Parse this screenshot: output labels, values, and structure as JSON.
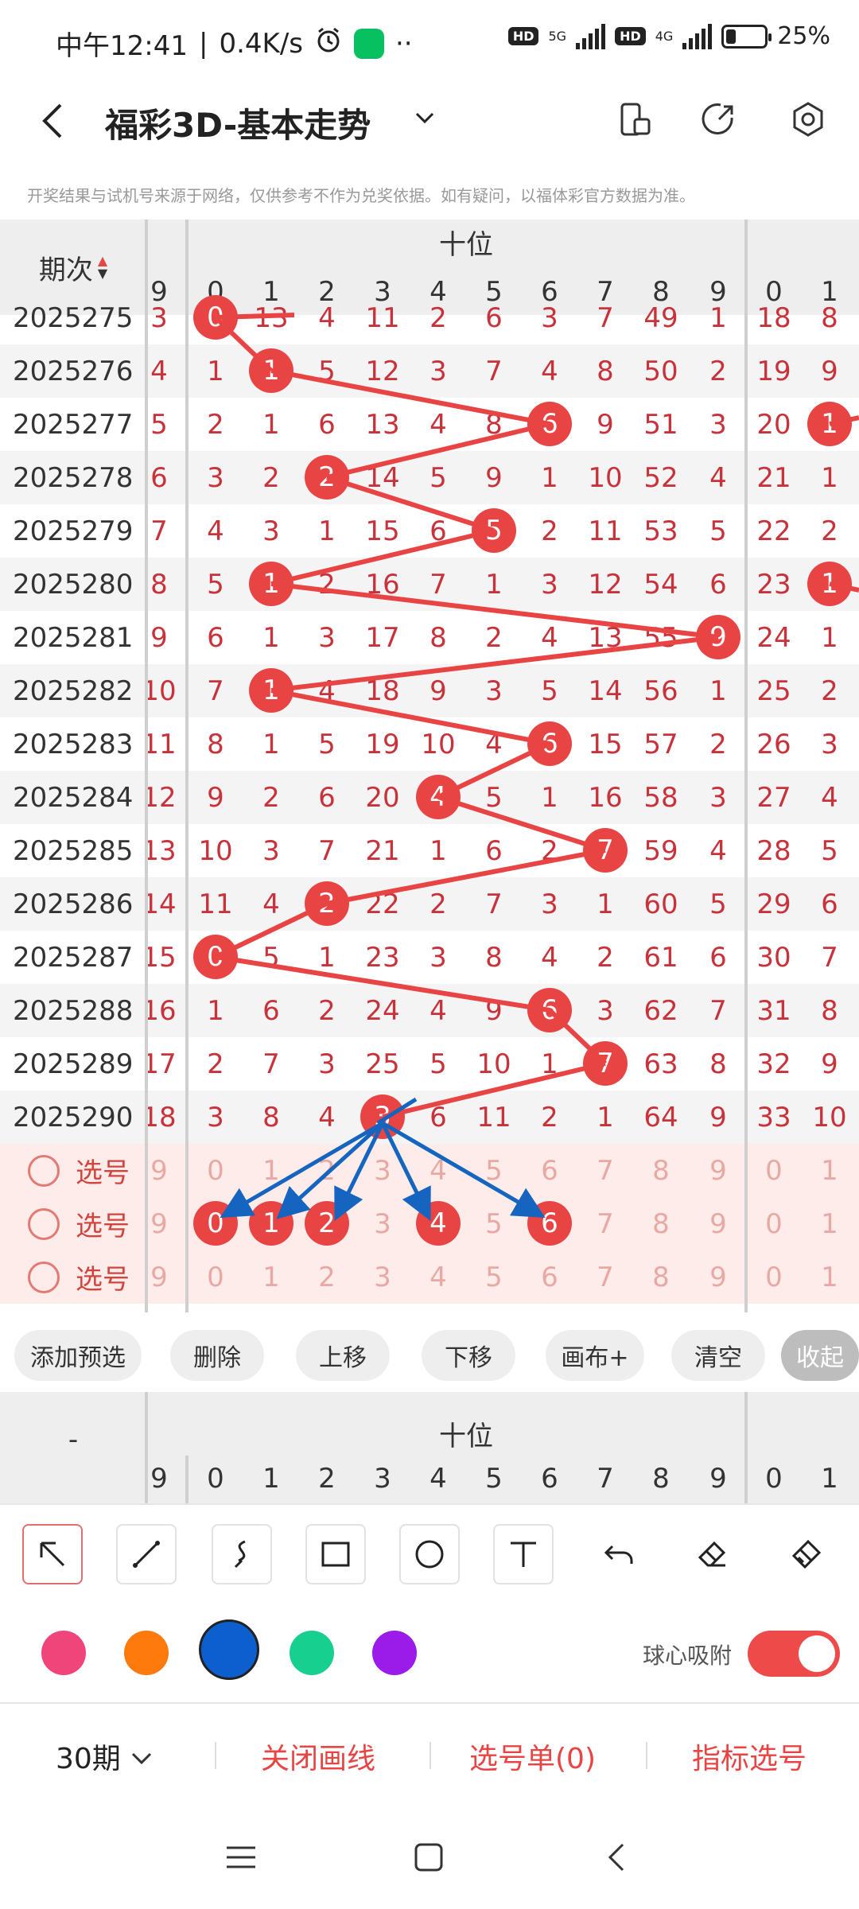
{
  "status": {
    "time": "中午12:41",
    "speed": "0.4K/s",
    "hd1": "HD",
    "net1": "5G",
    "hd2": "HD",
    "net2": "4G",
    "battery": "25%",
    "battery_level": 0.25
  },
  "header": {
    "title": "福彩3D-基本走势"
  },
  "disclaimer": "开奖结果与试机号来源于网络，仅供参考不作为兑奖依据。如有疑问，以福体彩官方数据为准。",
  "grid": {
    "issue_header": "期次",
    "position": "十位",
    "columns": [
      "9",
      "0",
      "1",
      "2",
      "3",
      "4",
      "5",
      "6",
      "7",
      "8",
      "9",
      "0",
      "1"
    ],
    "rows": [
      {
        "issue": "2025275",
        "cells": [
          "3",
          "0",
          "13",
          "4",
          "11",
          "2",
          "6",
          "3",
          "7",
          "49",
          "1",
          "18",
          "8"
        ],
        "ball": 1
      },
      {
        "issue": "2025276",
        "cells": [
          "4",
          "1",
          "1",
          "5",
          "12",
          "3",
          "7",
          "4",
          "8",
          "50",
          "2",
          "19",
          "9"
        ],
        "ball": 2
      },
      {
        "issue": "2025277",
        "cells": [
          "5",
          "2",
          "1",
          "6",
          "13",
          "4",
          "8",
          "6",
          "9",
          "51",
          "3",
          "20",
          "1"
        ],
        "ball": 7
      },
      {
        "issue": "2025278",
        "cells": [
          "6",
          "3",
          "2",
          "2",
          "14",
          "5",
          "9",
          "1",
          "10",
          "52",
          "4",
          "21",
          "1"
        ],
        "ball": 3
      },
      {
        "issue": "2025279",
        "cells": [
          "7",
          "4",
          "3",
          "1",
          "15",
          "6",
          "5",
          "2",
          "11",
          "53",
          "5",
          "22",
          "2"
        ],
        "ball": 6
      },
      {
        "issue": "2025280",
        "cells": [
          "8",
          "5",
          "1",
          "2",
          "16",
          "7",
          "1",
          "3",
          "12",
          "54",
          "6",
          "23",
          "1"
        ],
        "ball": 2
      },
      {
        "issue": "2025281",
        "cells": [
          "9",
          "6",
          "1",
          "3",
          "17",
          "8",
          "2",
          "4",
          "13",
          "55",
          "9",
          "24",
          "1"
        ],
        "ball": 10
      },
      {
        "issue": "2025282",
        "cells": [
          "10",
          "7",
          "1",
          "4",
          "18",
          "9",
          "3",
          "5",
          "14",
          "56",
          "1",
          "25",
          "2"
        ],
        "ball": 2
      },
      {
        "issue": "2025283",
        "cells": [
          "11",
          "8",
          "1",
          "5",
          "19",
          "10",
          "4",
          "6",
          "15",
          "57",
          "2",
          "26",
          "3"
        ],
        "ball": 7
      },
      {
        "issue": "2025284",
        "cells": [
          "12",
          "9",
          "2",
          "6",
          "20",
          "4",
          "5",
          "1",
          "16",
          "58",
          "3",
          "27",
          "4"
        ],
        "ball": 5
      },
      {
        "issue": "2025285",
        "cells": [
          "13",
          "10",
          "3",
          "7",
          "21",
          "1",
          "6",
          "2",
          "7",
          "59",
          "4",
          "28",
          "5"
        ],
        "ball": 8
      },
      {
        "issue": "2025286",
        "cells": [
          "14",
          "11",
          "4",
          "2",
          "22",
          "2",
          "7",
          "3",
          "1",
          "60",
          "5",
          "29",
          "6"
        ],
        "ball": 3
      },
      {
        "issue": "2025287",
        "cells": [
          "15",
          "0",
          "5",
          "1",
          "23",
          "3",
          "8",
          "4",
          "2",
          "61",
          "6",
          "30",
          "7"
        ],
        "ball": 1
      },
      {
        "issue": "2025288",
        "cells": [
          "16",
          "1",
          "6",
          "2",
          "24",
          "4",
          "9",
          "6",
          "3",
          "62",
          "7",
          "31",
          "8"
        ],
        "ball": 7
      },
      {
        "issue": "2025289",
        "cells": [
          "17",
          "2",
          "7",
          "3",
          "25",
          "5",
          "10",
          "1",
          "7",
          "63",
          "8",
          "32",
          "9"
        ],
        "ball": 8
      },
      {
        "issue": "2025290",
        "cells": [
          "18",
          "3",
          "8",
          "4",
          "3",
          "6",
          "11",
          "2",
          "1",
          "64",
          "9",
          "33",
          "10"
        ],
        "ball": 4
      }
    ],
    "select_label": "选号",
    "select_rows": [
      {
        "cells": [
          "9",
          "0",
          "1",
          "2",
          "3",
          "4",
          "5",
          "6",
          "7",
          "8",
          "9",
          "0",
          "1"
        ],
        "balls": []
      },
      {
        "cells": [
          "9",
          "0",
          "1",
          "2",
          "3",
          "4",
          "5",
          "6",
          "7",
          "8",
          "9",
          "0",
          "1"
        ],
        "balls": [
          1,
          2,
          3,
          5,
          7
        ]
      },
      {
        "cells": [
          "9",
          "0",
          "1",
          "2",
          "3",
          "4",
          "5",
          "6",
          "7",
          "8",
          "9",
          "0",
          "1"
        ],
        "balls": []
      }
    ],
    "extra_balls": [
      {
        "row": 2,
        "label": "1"
      },
      {
        "row": 5,
        "label": "1"
      }
    ]
  },
  "actions": [
    "添加预选",
    "删除",
    "上移",
    "下移",
    "画布+",
    "清空",
    "收起"
  ],
  "grid2": {
    "dash": "-",
    "position": "十位",
    "columns": [
      "9",
      "0",
      "1",
      "2",
      "3",
      "4",
      "5",
      "6",
      "7",
      "8",
      "9",
      "0",
      "1"
    ]
  },
  "draw_tools": [
    "select-arrow-icon",
    "line-icon",
    "curve-icon",
    "rectangle-icon",
    "circle-icon",
    "text-icon",
    "undo-icon",
    "eraser-icon",
    "clear-brush-icon"
  ],
  "colors": [
    "#f0457a",
    "#ff7a0c",
    "#0d5fcf",
    "#17cf8e",
    "#9b1ce8"
  ],
  "active_color": "#0d5fcf",
  "snap_label": "球心吸附",
  "snap_on": true,
  "bottom": {
    "periods": "30期",
    "close_lines": "关闭画线",
    "selection": "选号单(0)",
    "indicator": "指标选号"
  },
  "accent": "#e84444",
  "arrow_color": "#1565c0"
}
